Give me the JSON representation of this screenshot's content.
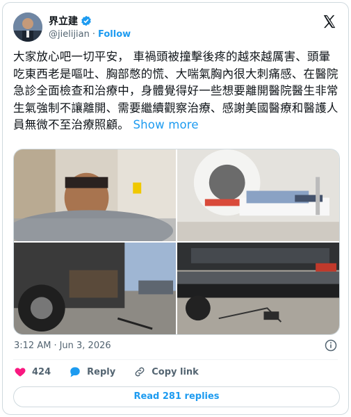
{
  "author": {
    "name": "界立建",
    "handle": "@jielijian",
    "separator": "·",
    "follow_label": "Follow"
  },
  "tweet": {
    "text": "大家放心吧一切平安， 車禍頭被撞擊後疼的越來越厲害、頭暈吃東西老是嘔吐、胸部憋的慌、大喘氣胸內很大刺痛感、在醫院急診全面檢查和治療中，身體覺得好一些想要離開醫院醫生非常生氣強制不讓離開、需要繼續觀察治療、感謝美國醫療和醫護人員無微不至治療照顧。",
    "show_more": "Show more"
  },
  "media": [
    {
      "description_icon": "hospital-selfie-photo"
    },
    {
      "description_icon": "ct-scan-photo"
    },
    {
      "description_icon": "damaged-car-front-photo"
    },
    {
      "description_icon": "damaged-bumper-photo"
    }
  ],
  "meta": {
    "time": "3:12 AM",
    "dot": "·",
    "date": "Jun 3, 2026"
  },
  "actions": {
    "like_count": "424",
    "reply_label": "Reply",
    "copy_link_label": "Copy link"
  },
  "footer": {
    "read_replies_label": "Read 281 replies"
  },
  "colors": {
    "accent": "#1d9bf0",
    "like": "#f91880",
    "text": "#0f1419",
    "muted": "#536471"
  }
}
